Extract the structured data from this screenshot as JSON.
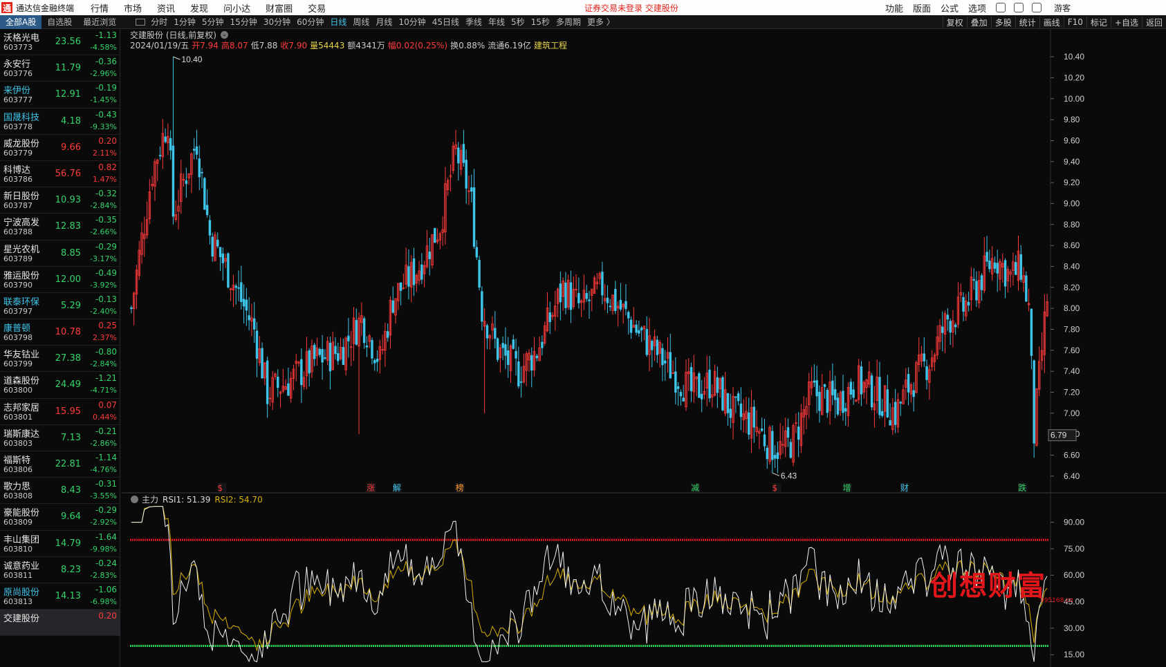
{
  "app": {
    "logo": "通",
    "title": "通达信金融终端"
  },
  "menu": [
    "行情",
    "市场",
    "资讯",
    "发现",
    "问小达",
    "财富圈",
    "交易"
  ],
  "notice": "证券交易未登录  交建股份",
  "menu_right": [
    "功能",
    "版面",
    "公式",
    "选项"
  ],
  "icons": [
    "refresh-icon",
    "phone-icon",
    "mail-icon"
  ],
  "guest": "游客",
  "list_tabs": [
    "全部A股",
    "自选股",
    "最近浏览"
  ],
  "periods": [
    "分时",
    "1分钟",
    "5分钟",
    "15分钟",
    "30分钟",
    "60分钟",
    "日线",
    "周线",
    "月线",
    "10分钟",
    "45日线",
    "季线",
    "年线",
    "5秒",
    "15秒",
    "多周期",
    "更多 〉"
  ],
  "active_period": "日线",
  "tool_right": [
    "复权",
    "叠加",
    "多股",
    "统计",
    "画线",
    "F10",
    "标记",
    "+自选",
    "返回"
  ],
  "colors": {
    "up": "#ff3b3b",
    "down": "#33d46a",
    "cyan": "#3ec4e8",
    "yellow": "#e6d44a",
    "ma": "#d8b100",
    "rsi1": "#ffffff"
  },
  "stocks": [
    {
      "name": "沃格光电",
      "code": "603773",
      "price": "23.56",
      "chg": "-1.13",
      "pct": "-4.58%",
      "dir": "down"
    },
    {
      "name": "永安行",
      "code": "603776",
      "price": "11.79",
      "chg": "-0.36",
      "pct": "-2.96%",
      "dir": "down"
    },
    {
      "name": "来伊份",
      "code": "603777",
      "price": "12.91",
      "chg": "-0.19",
      "pct": "-1.45%",
      "dir": "down",
      "hl": "cyan"
    },
    {
      "name": "国晟科技",
      "code": "603778",
      "price": "4.18",
      "chg": "-0.43",
      "pct": "-9.33%",
      "dir": "down",
      "hl": "cyan"
    },
    {
      "name": "威龙股份",
      "code": "603779",
      "price": "9.66",
      "chg": "0.20",
      "pct": "2.11%",
      "dir": "up"
    },
    {
      "name": "科博达",
      "code": "603786",
      "price": "56.76",
      "chg": "0.82",
      "pct": "1.47%",
      "dir": "up"
    },
    {
      "name": "新日股份",
      "code": "603787",
      "price": "10.93",
      "chg": "-0.32",
      "pct": "-2.84%",
      "dir": "down"
    },
    {
      "name": "宁波高发",
      "code": "603788",
      "price": "12.83",
      "chg": "-0.35",
      "pct": "-2.66%",
      "dir": "down"
    },
    {
      "name": "星光农机",
      "code": "603789",
      "price": "8.85",
      "chg": "-0.29",
      "pct": "-3.17%",
      "dir": "down"
    },
    {
      "name": "雅运股份",
      "code": "603790",
      "price": "12.00",
      "chg": "-0.49",
      "pct": "-3.92%",
      "dir": "down"
    },
    {
      "name": "联泰环保",
      "code": "603797",
      "price": "5.29",
      "chg": "-0.13",
      "pct": "-2.40%",
      "dir": "down",
      "hl": "cyan"
    },
    {
      "name": "康普顿",
      "code": "603798",
      "price": "10.78",
      "chg": "0.25",
      "pct": "2.37%",
      "dir": "up",
      "hl": "cyan"
    },
    {
      "name": "华友钴业",
      "code": "603799",
      "price": "27.38",
      "chg": "-0.80",
      "pct": "-2.84%",
      "dir": "down"
    },
    {
      "name": "道森股份",
      "code": "603800",
      "price": "24.49",
      "chg": "-1.21",
      "pct": "-4.71%",
      "dir": "down"
    },
    {
      "name": "志邦家居",
      "code": "603801",
      "price": "15.95",
      "chg": "0.07",
      "pct": "0.44%",
      "dir": "up"
    },
    {
      "name": "瑞斯康达",
      "code": "603803",
      "price": "7.13",
      "chg": "-0.21",
      "pct": "-2.86%",
      "dir": "down"
    },
    {
      "name": "福斯特",
      "code": "603806",
      "price": "22.81",
      "chg": "-1.14",
      "pct": "-4.76%",
      "dir": "down"
    },
    {
      "name": "歌力思",
      "code": "603808",
      "price": "8.43",
      "chg": "-0.31",
      "pct": "-3.55%",
      "dir": "down"
    },
    {
      "name": "豪能股份",
      "code": "603809",
      "price": "9.64",
      "chg": "-0.29",
      "pct": "-2.92%",
      "dir": "down"
    },
    {
      "name": "丰山集团",
      "code": "603810",
      "price": "14.79",
      "chg": "-1.64",
      "pct": "-9.98%",
      "dir": "down"
    },
    {
      "name": "诚意药业",
      "code": "603811",
      "price": "8.23",
      "chg": "-0.24",
      "pct": "-2.83%",
      "dir": "down"
    },
    {
      "name": "原尚股份",
      "code": "603813",
      "price": "14.13",
      "chg": "-1.06",
      "pct": "-6.98%",
      "dir": "down",
      "hl": "cyan"
    },
    {
      "name": "交建股份",
      "code": "",
      "price": "",
      "chg": "0.20",
      "pct": "",
      "dir": "up",
      "sel": true
    }
  ],
  "chart": {
    "title": "交建股份 (日线,前复权)",
    "date": "2024/01/19/五",
    "open": "开7.94",
    "high": "高8.07",
    "low": "低7.88",
    "close": "收7.90",
    "vol": "量54443",
    "amount": "额4341万",
    "range": "幅0.02(0.25%)",
    "turnover": "换0.88%",
    "float": "流通6.19亿",
    "sector": "建筑工程",
    "max_label": "10.40",
    "min_label": "6.43",
    "last_label": "6.79",
    "events": [
      {
        "text": "$",
        "c": "up",
        "i": 35
      },
      {
        "text": "涨",
        "c": "up",
        "i": 92
      },
      {
        "text": "解",
        "c": "cyan",
        "i": 102
      },
      {
        "text": "榜",
        "c": "orange",
        "i": 126
      },
      {
        "text": "减",
        "c": "down",
        "i": 216
      },
      {
        "text": "$",
        "c": "up",
        "i": 247
      },
      {
        "text": "增",
        "c": "down",
        "i": 274
      },
      {
        "text": "财",
        "c": "cyan",
        "i": 296
      },
      {
        "text": "跌",
        "c": "down",
        "i": 341
      }
    ]
  },
  "chart_data": {
    "type": "candlestick",
    "ylim": [
      6.3,
      10.48
    ],
    "yticks": [
      "10.40",
      "10.20",
      "10.00",
      "9.80",
      "9.60",
      "9.40",
      "9.20",
      "9.00",
      "8.80",
      "8.60",
      "8.40",
      "8.20",
      "8.00",
      "7.80",
      "7.60",
      "7.40",
      "7.20",
      "7.00",
      "6.80",
      "6.60",
      "6.40"
    ],
    "knots": [
      [
        0,
        8.0
      ],
      [
        3,
        8.5
      ],
      [
        8,
        9.3
      ],
      [
        14,
        9.8
      ],
      [
        16,
        8.9
      ],
      [
        25,
        9.6
      ],
      [
        30,
        8.7
      ],
      [
        38,
        8.3
      ],
      [
        47,
        7.8
      ],
      [
        52,
        7.2
      ],
      [
        60,
        7.3
      ],
      [
        70,
        7.5
      ],
      [
        80,
        7.6
      ],
      [
        88,
        7.9
      ],
      [
        95,
        7.5
      ],
      [
        100,
        8.1
      ],
      [
        110,
        8.4
      ],
      [
        118,
        8.8
      ],
      [
        124,
        9.5
      ],
      [
        128,
        9.2
      ],
      [
        130,
        9.0
      ],
      [
        134,
        8.0
      ],
      [
        140,
        7.6
      ],
      [
        148,
        7.4
      ],
      [
        155,
        7.6
      ],
      [
        160,
        7.9
      ],
      [
        165,
        8.2
      ],
      [
        172,
        8.0
      ],
      [
        180,
        8.2
      ],
      [
        187,
        8.0
      ],
      [
        193,
        7.8
      ],
      [
        200,
        7.6
      ],
      [
        207,
        7.4
      ],
      [
        214,
        7.2
      ],
      [
        222,
        7.3
      ],
      [
        230,
        7.0
      ],
      [
        238,
        6.9
      ],
      [
        244,
        6.7
      ],
      [
        249,
        6.65
      ],
      [
        253,
        6.75
      ],
      [
        260,
        7.2
      ],
      [
        270,
        7.1
      ],
      [
        277,
        7.3
      ],
      [
        284,
        7.2
      ],
      [
        292,
        7.0
      ],
      [
        298,
        7.3
      ],
      [
        305,
        7.5
      ],
      [
        312,
        7.9
      ],
      [
        318,
        8.0
      ],
      [
        325,
        8.3
      ],
      [
        330,
        8.5
      ],
      [
        336,
        8.3
      ],
      [
        340,
        8.4
      ],
      [
        343,
        8.0
      ],
      [
        345,
        6.8
      ],
      [
        348,
        7.6
      ],
      [
        350,
        8.1
      ]
    ],
    "n": 351,
    "rsi": {
      "ylim": [
        10,
        100
      ],
      "yticks": [
        90,
        75,
        60,
        45,
        30,
        15
      ],
      "overbought": 80,
      "oversold": 20,
      "rsi1_last": 51.39,
      "rsi2_last": 54.7
    }
  },
  "indicator": {
    "name": "主力",
    "rsi1": "RSI1: 51.39",
    "rsi2": "RSI2: 54.70"
  },
  "watermark": {
    "text": "创想财富",
    "url": "995168.cn"
  }
}
